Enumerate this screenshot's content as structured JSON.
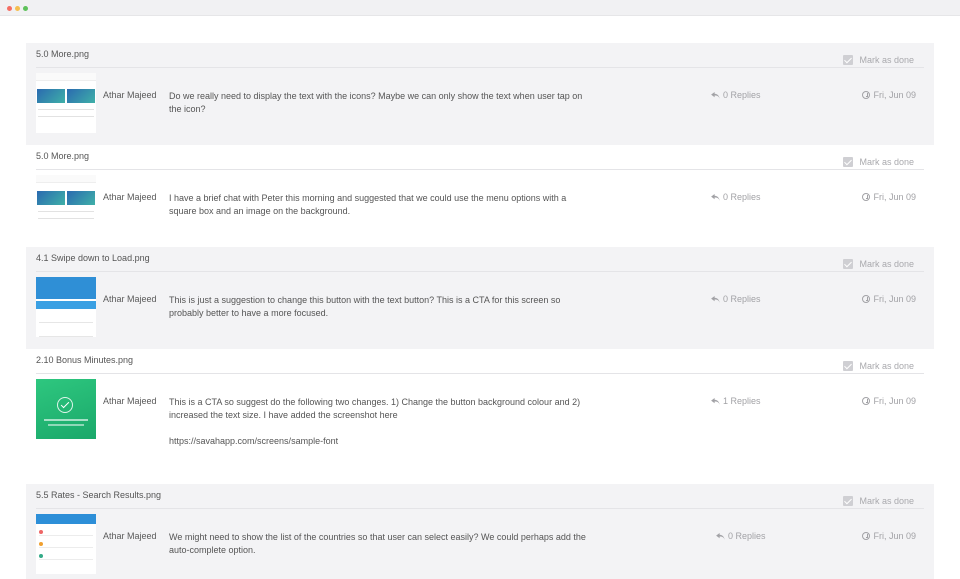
{
  "window": {
    "controls": [
      "close",
      "minimize",
      "maximize"
    ]
  },
  "items": [
    {
      "file": "5.0 More.png",
      "mark_label": "Mark as done",
      "author": "Athar Majeed",
      "comment": "Do we really need to display the text with the icons? Maybe we can only show the text when user tap on the icon?",
      "link": "",
      "replies": "0 Replies",
      "date": "Fri, Jun 09",
      "thumbnail": "phone-grid"
    },
    {
      "file": "5.0 More.png",
      "mark_label": "Mark as done",
      "author": "Athar Majeed",
      "comment": "I have a brief chat with Peter this morning and suggested that we could use the menu options with a square box and an image on the background.",
      "link": "",
      "replies": "0 Replies",
      "date": "Fri, Jun 09",
      "thumbnail": "phone-grid"
    },
    {
      "file": "4.1 Swipe down to Load.png",
      "mark_label": "Mark as done",
      "author": "Athar Majeed",
      "comment": "This is just a suggestion to change this button with the text button? This is a CTA for this screen so probably better to have a more focused.",
      "link": "",
      "replies": "0 Replies",
      "date": "Fri, Jun 09",
      "thumbnail": "swipe"
    },
    {
      "file": "2.10 Bonus Minutes.png",
      "mark_label": "Mark as done",
      "author": "Athar Majeed",
      "comment": "This is a CTA so suggest do the following two changes. 1) Change the button background colour and 2) increased the text size. I have added the screenshot here",
      "link": "https://savahapp.com/screens/sample-font",
      "replies": "1 Replies",
      "date": "Fri, Jun 09",
      "thumbnail": "green"
    },
    {
      "file": "5.5 Rates - Search Results.png",
      "mark_label": "Mark as done",
      "author": "Athar Majeed",
      "comment": "We might need to show the list of the countries so that user can select easily? We could perhaps add the auto-complete option.",
      "link": "",
      "replies": "0 Replies",
      "date": "Fri, Jun 09",
      "thumbnail": "rates"
    }
  ],
  "icons": {
    "reply": "reply-icon",
    "clock": "clock-icon",
    "check": "checkbox-icon"
  },
  "colors": {
    "row_shade": "#f3f3f5",
    "muted_text": "#a2a2a6",
    "accent_green": "#2ec77f",
    "accent_blue": "#2f8fd6"
  }
}
